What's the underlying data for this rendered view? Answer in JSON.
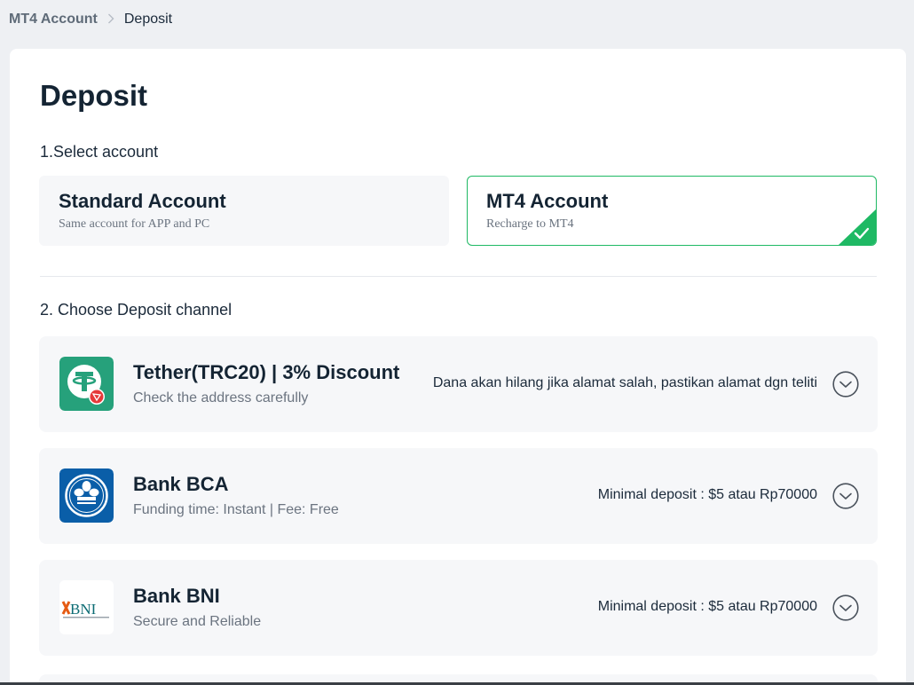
{
  "breadcrumb": {
    "parent": "MT4 Account",
    "separator": ">",
    "current": "Deposit"
  },
  "page": {
    "title": "Deposit"
  },
  "select_account": {
    "label": "1.Select account",
    "accounts": [
      {
        "name": "Standard Account",
        "desc": "Same account for APP and PC",
        "selected": false
      },
      {
        "name": "MT4 Account",
        "desc": "Recharge to MT4",
        "selected": true
      }
    ]
  },
  "deposit_channel": {
    "label": "2. Choose Deposit channel",
    "channels": [
      {
        "icon": "tether-trc20-icon",
        "name": "Tether(TRC20) | 3% Discount",
        "desc": "Check the address carefully",
        "note": "Dana akan hilang jika alamat salah, pastikan alamat dgn teliti"
      },
      {
        "icon": "bank-bca-icon",
        "name": "Bank BCA",
        "desc": "Funding time: Instant | Fee: Free",
        "note": "Minimal deposit : $5 atau Rp70000"
      },
      {
        "icon": "bank-bni-icon",
        "name": "Bank BNI",
        "desc": "Secure and Reliable",
        "note": "Minimal deposit : $5 atau Rp70000",
        "logo_text": "BNI"
      }
    ]
  },
  "colors": {
    "accent": "#1fb964",
    "tether": "#26a17b",
    "bca": "#0a5ea8",
    "bni_orange": "#e55b13",
    "bni_teal": "#0b6b73"
  }
}
